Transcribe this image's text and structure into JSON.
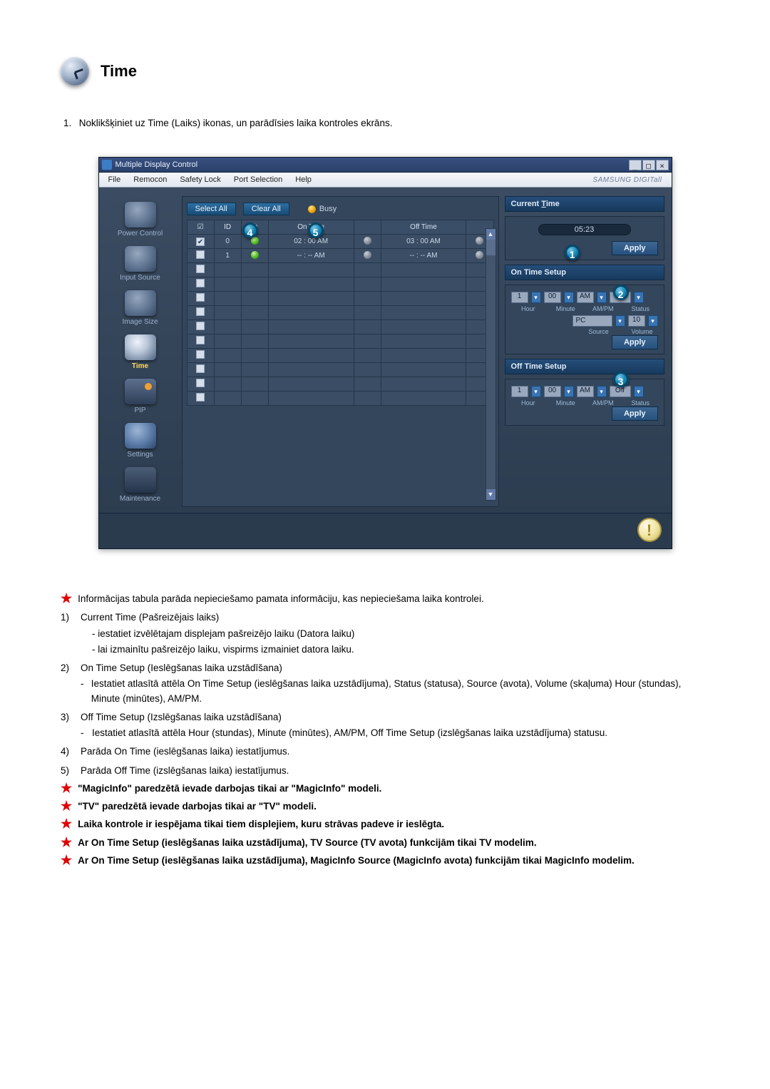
{
  "page": {
    "title": "Time",
    "step1_num": "1.",
    "step1_text": "Noklikšķiniet uz Time (Laiks) ikonas, un parādīsies laika kontroles ekrāns."
  },
  "window": {
    "title": "Multiple Display Control",
    "brand": "SAMSUNG DIGITall",
    "menu": {
      "file": "File",
      "remocon": "Remocon",
      "safety": "Safety Lock",
      "port": "Port Selection",
      "help": "Help"
    },
    "winbtns": {
      "min": "_",
      "max": "□",
      "close": "×"
    }
  },
  "sidebar": {
    "items": [
      {
        "label": "Power Control"
      },
      {
        "label": "Input Source"
      },
      {
        "label": "Image Size"
      },
      {
        "label": "Time"
      },
      {
        "label": "PIP"
      },
      {
        "label": "Settings"
      },
      {
        "label": "Maintenance"
      }
    ]
  },
  "center": {
    "select_all": "Select All",
    "clear_all": "Clear All",
    "busy": "Busy",
    "cols": {
      "chk": "☑",
      "id": "ID",
      "st1": "⏻",
      "on": "On Time",
      "st2": "",
      "off": "Off Time",
      "st3": ""
    },
    "rows": [
      {
        "chk": true,
        "id": "0",
        "s1": "g",
        "on": "02 : 00 AM",
        "s2": "y",
        "off": "03 : 00 AM",
        "s3": "y"
      },
      {
        "chk": false,
        "id": "1",
        "s1": "g",
        "on": "-- : -- AM",
        "s2": "y",
        "off": "-- : -- AM",
        "s3": "y"
      }
    ],
    "badges": {
      "b4": "4",
      "b5": "5"
    }
  },
  "right": {
    "current_label_pre": "Current ",
    "current_label_u": "T",
    "current_label_post": "ime",
    "time": "05:23",
    "badge1": "1",
    "apply": "Apply",
    "ontime_label": "On Time Setup",
    "badge2": "2",
    "offtime_label": "Off Time Setup",
    "badge3": "3",
    "hour": "1",
    "min": "00",
    "ampm": "AM",
    "status": "Off",
    "lbls": {
      "hour": "Hour",
      "minute": "Minute",
      "ampm": "AM/PM",
      "status": "Status",
      "source": "Source",
      "volume": "Volume"
    },
    "source": "PC",
    "volume": "10"
  },
  "notes": {
    "intro": "Informācijas tabula parāda nepieciešamo pamata informāciju, kas nepieciešama laika kontrolei.",
    "n1": {
      "n": "1)",
      "t": "Current Time (Pašreizējais laiks)",
      "s": [
        "- iestatiet izvēlētajam displejam pašreizējo laiku (Datora laiku)",
        "- lai izmainītu pašreizējo laiku, vispirms izmainiet datora laiku."
      ]
    },
    "n2": {
      "n": "2)",
      "t": "On Time Setup (Ieslēgšanas laika uzstādīšana)",
      "s": [
        "Iestatiet atlasītā attēla On Time Setup (ieslēgšanas laika uzstādījuma), Status (statusa), Source (avota), Volume (skaļuma) Hour (stundas), Minute (minūtes), AM/PM."
      ]
    },
    "n3": {
      "n": "3)",
      "t": "Off Time Setup (Izslēgšanas laika uzstādīšana)",
      "s": [
        "Iestatiet atlasītā attēla Hour (stundas), Minute (minūtes), AM/PM, Off Time Setup (izslēgšanas laika uzstādījuma) statusu."
      ]
    },
    "n4": {
      "n": "4)",
      "t": "Parāda On Time (ieslēgšanas laika) iestatījumus."
    },
    "n5": {
      "n": "5)",
      "t": "Parāda Off Time (izslēgšanas laika) iestatījumus."
    },
    "s1": "\"MagicInfo\" paredzētā ievade darbojas tikai ar \"MagicInfo\" modeli.",
    "s2": "\"TV\" paredzētā ievade darbojas tikai ar \"TV\" modeli.",
    "s3": "Laika kontrole ir iespējama tikai tiem displejiem, kuru strāvas padeve ir ieslēgta.",
    "s4": "Ar On Time Setup (ieslēgšanas laika uzstādījuma), TV Source (TV avota) funkcijām tikai TV modelim.",
    "s5": "Ar On Time Setup (ieslēgšanas laika uzstādījuma), MagicInfo Source (MagicInfo avota) funkcijām tikai MagicInfo modelim."
  }
}
